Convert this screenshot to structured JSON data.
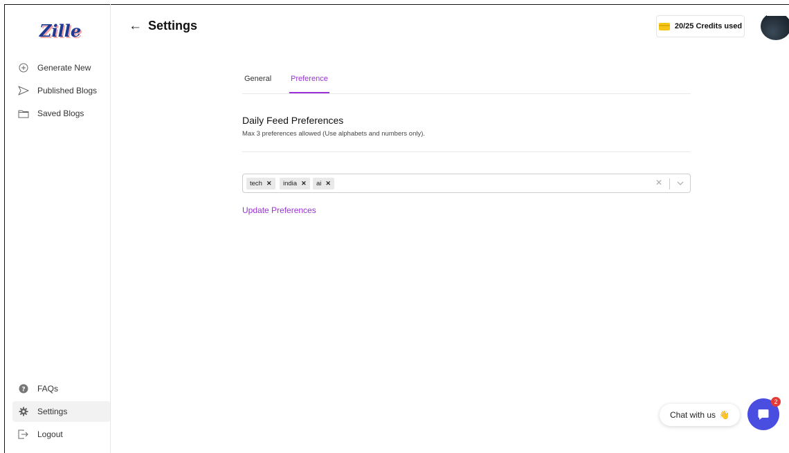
{
  "app": {
    "logo_text": "Zille"
  },
  "sidebar": {
    "top_items": [
      {
        "label": "Generate New",
        "icon": "plus-circle-icon"
      },
      {
        "label": "Published Blogs",
        "icon": "send-icon"
      },
      {
        "label": "Saved Blogs",
        "icon": "folder-icon"
      }
    ],
    "bottom_items": [
      {
        "label": "FAQs",
        "icon": "question-circle-icon"
      },
      {
        "label": "Settings",
        "icon": "gear-icon",
        "active": true
      },
      {
        "label": "Logout",
        "icon": "logout-icon"
      }
    ]
  },
  "header": {
    "title": "Settings",
    "credits": "20/25 Credits used"
  },
  "tabs": [
    {
      "label": "General",
      "active": false
    },
    {
      "label": "Preference",
      "active": true
    }
  ],
  "preferences": {
    "title": "Daily Feed Preferences",
    "subtitle": "Max 3 preferences allowed (Use alphabets and numbers only).",
    "chips": [
      "tech",
      "india",
      "ai"
    ],
    "update_label": "Update Preferences"
  },
  "chat": {
    "label": "Chat with us",
    "wave": "👋",
    "badge": "2"
  },
  "colors": {
    "accent": "#9b30d9",
    "chat_button": "#4a4ee0",
    "badge": "#e53935",
    "credit_card": "#f5c518"
  }
}
